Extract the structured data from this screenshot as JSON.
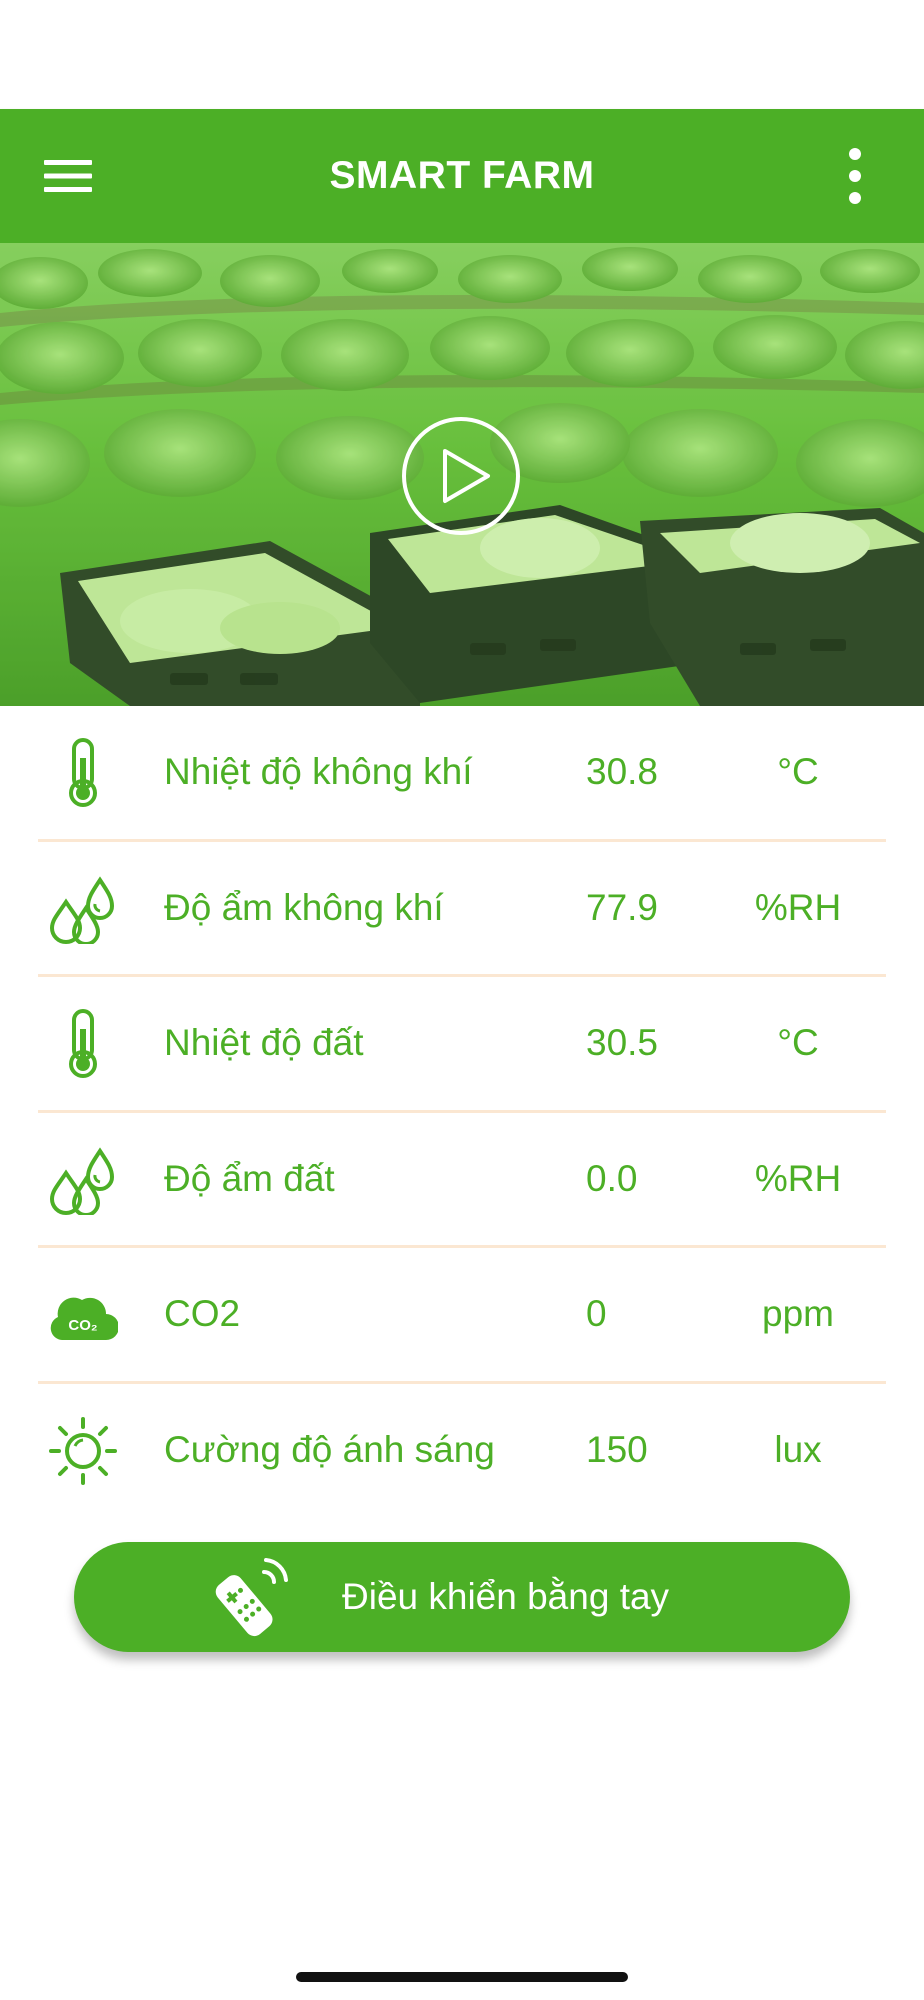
{
  "app": {
    "title": "SMART FARM"
  },
  "colors": {
    "primary": "#4caf26",
    "divider": "#fbe7d2",
    "text_on_primary": "#ffffff"
  },
  "icons": {
    "menu": "hamburger-menu-icon",
    "more": "more-vertical-icon",
    "play": "play-circle-icon",
    "remote": "remote-control-icon"
  },
  "sensors": [
    {
      "icon": "thermometer-icon",
      "label": "Nhiệt độ không khí",
      "value": "30.8",
      "unit": "°C"
    },
    {
      "icon": "water-drops-icon",
      "label": "Độ ẩm không khí",
      "value": "77.9",
      "unit": "%RH"
    },
    {
      "icon": "thermometer-icon",
      "label": "Nhiệt độ đất",
      "value": "30.5",
      "unit": "°C"
    },
    {
      "icon": "water-drops-icon",
      "label": "Độ ẩm đất",
      "value": "0.0",
      "unit": "%RH"
    },
    {
      "icon": "co2-cloud-icon",
      "label": "CO2",
      "value": "0",
      "unit": "ppm"
    },
    {
      "icon": "sun-icon",
      "label": "Cường độ ánh sáng",
      "value": "150",
      "unit": "lux"
    }
  ],
  "manual_control": {
    "label": "Điều khiển bằng tay"
  },
  "co2_icon_text": "CO₂"
}
